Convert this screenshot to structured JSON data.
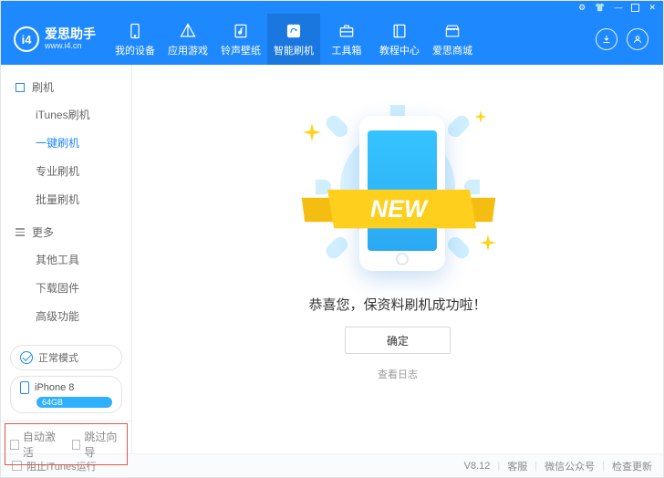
{
  "brand": {
    "cn": "爱思助手",
    "en": "www.i4.cn",
    "logo_letters": "i4"
  },
  "nav": [
    {
      "label": "我的设备",
      "icon": "phone"
    },
    {
      "label": "应用游戏",
      "icon": "apps"
    },
    {
      "label": "铃声壁纸",
      "icon": "music"
    },
    {
      "label": "智能刷机",
      "icon": "flash",
      "active": true
    },
    {
      "label": "工具箱",
      "icon": "briefcase"
    },
    {
      "label": "教程中心",
      "icon": "book"
    },
    {
      "label": "爱思商城",
      "icon": "store"
    }
  ],
  "header_buttons": {
    "download": "download-icon",
    "user": "user-icon"
  },
  "window_controls": [
    "settings-icon",
    "skin-icon",
    "minimize-icon",
    "maximize-icon",
    "close-icon"
  ],
  "sidebar": {
    "groups": [
      {
        "title": "刷机",
        "items": [
          "iTunes刷机",
          "一键刷机",
          "专业刷机",
          "批量刷机"
        ],
        "active_index": 1
      },
      {
        "title": "更多",
        "items": [
          "其他工具",
          "下载固件",
          "高级功能"
        ]
      }
    ]
  },
  "mode": {
    "label": "正常模式"
  },
  "device": {
    "name": "iPhone 8",
    "capacity": "64GB"
  },
  "bottom_options": {
    "auto_activate": "自动激活",
    "skip_guide": "跳过向导"
  },
  "main": {
    "ribbon_text": "NEW",
    "congrats": "恭喜您，保资料刷机成功啦！",
    "ok": "确定",
    "view_log": "查看日志"
  },
  "statusbar": {
    "block_itunes": "阻止iTunes运行",
    "version": "V8.12",
    "support": "客服",
    "wechat": "微信公众号",
    "update": "检查更新"
  }
}
